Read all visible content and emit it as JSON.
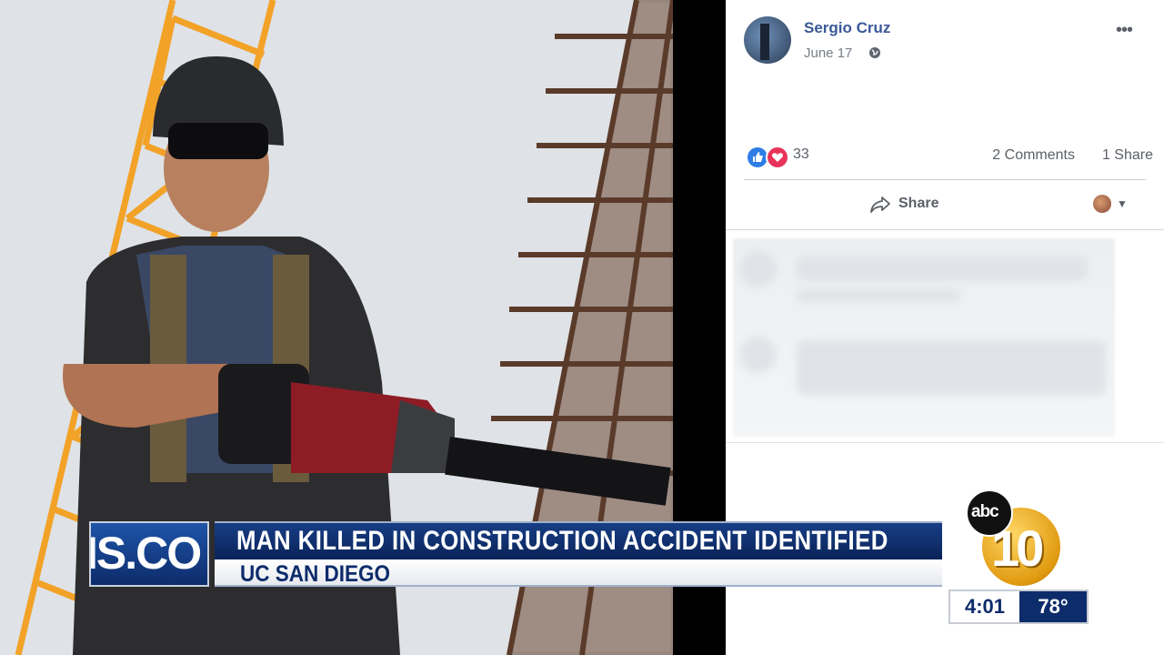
{
  "post": {
    "author": "Sergio Cruz",
    "date": "June 17",
    "reaction_count": "33",
    "comments": "2 Comments",
    "shares": "1 Share",
    "share_label": "Share"
  },
  "icons": [
    "globe-icon",
    "more-icon",
    "like-icon",
    "love-icon",
    "share-icon",
    "caret-down-icon"
  ],
  "lower_third": {
    "logo_text": "IS.CO",
    "headline": "MAN KILLED IN CONSTRUCTION ACCIDENT IDENTIFIED",
    "location": "UC SAN DIEGO"
  },
  "station": {
    "network": "abc",
    "channel": "10",
    "time": "4:01",
    "temperature": "78°"
  },
  "colors": {
    "facebook_blue": "#3b5998",
    "like_blue": "#2e7de6",
    "love_red": "#e8345a",
    "banner_navy": "#0d2c6b",
    "crane_orange": "#f2a227"
  }
}
